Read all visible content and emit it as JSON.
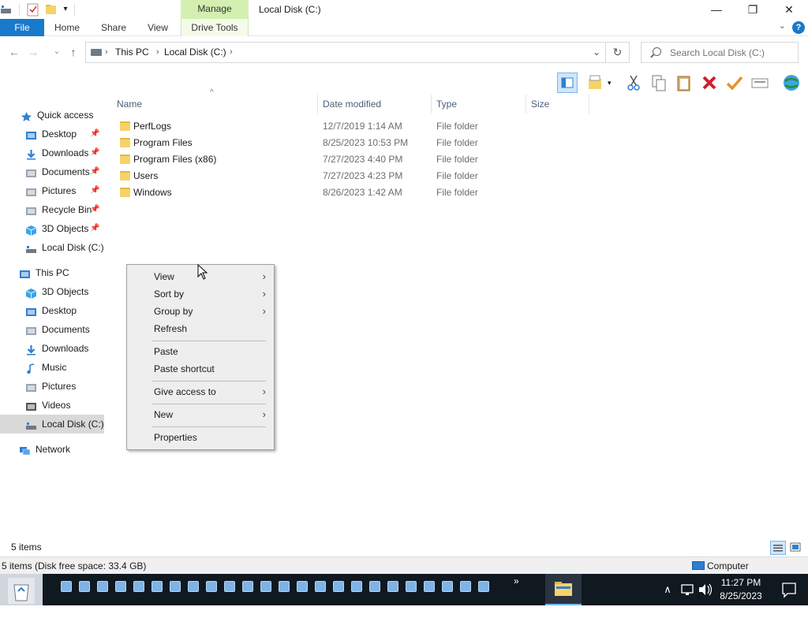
{
  "window": {
    "title": "Local Disk (C:)",
    "manage_tab": "Manage",
    "minimize": "—",
    "restore": "❐",
    "close": "✕"
  },
  "ribbon": {
    "tabs": [
      "File",
      "Home",
      "Share",
      "View",
      "Drive Tools"
    ],
    "help": "?",
    "collapse": "⌄"
  },
  "address": {
    "back": "←",
    "forward": "→",
    "recent": "⌄",
    "up": "↑",
    "segments": [
      "This PC",
      "Local Disk (C:)"
    ],
    "separator": "›",
    "dropdown": "⌄",
    "refresh": "↻"
  },
  "search": {
    "placeholder": "Search Local Disk (C:)"
  },
  "nav": {
    "items": [
      {
        "label": "Quick access",
        "icon": "star-icon",
        "pinned": false
      },
      {
        "label": "Desktop",
        "icon": "desktop-icon",
        "pinned": true
      },
      {
        "label": "Downloads",
        "icon": "download-icon",
        "pinned": true
      },
      {
        "label": "Documents",
        "icon": "documents-icon",
        "pinned": true
      },
      {
        "label": "Pictures",
        "icon": "pictures-icon",
        "pinned": true
      },
      {
        "label": "Recycle Bin",
        "icon": "recycle-bin-icon",
        "pinned": true
      },
      {
        "label": "3D Objects",
        "icon": "3d-objects-icon",
        "pinned": true
      },
      {
        "label": "Local Disk (C:)",
        "icon": "drive-icon",
        "pinned": false
      },
      {
        "label": "This PC",
        "icon": "computer-icon",
        "pinned": false
      },
      {
        "label": "3D Objects",
        "icon": "3d-objects-icon",
        "pinned": false
      },
      {
        "label": "Desktop",
        "icon": "desktop-icon",
        "pinned": false
      },
      {
        "label": "Documents",
        "icon": "documents-icon",
        "pinned": false
      },
      {
        "label": "Downloads",
        "icon": "download-icon",
        "pinned": false
      },
      {
        "label": "Music",
        "icon": "music-icon",
        "pinned": false
      },
      {
        "label": "Pictures",
        "icon": "pictures-icon",
        "pinned": false
      },
      {
        "label": "Videos",
        "icon": "videos-icon",
        "pinned": false
      },
      {
        "label": "Local Disk (C:)",
        "icon": "drive-icon",
        "pinned": false
      },
      {
        "label": "Network",
        "icon": "network-icon",
        "pinned": false
      }
    ],
    "pin_glyph": "📌"
  },
  "columns": {
    "name": "Name",
    "date": "Date modified",
    "type": "Type",
    "size": "Size",
    "sort_caret": "^"
  },
  "files": [
    {
      "name": "PerfLogs",
      "date": "12/7/2019 1:14 AM",
      "type": "File folder"
    },
    {
      "name": "Program Files",
      "date": "8/25/2023 10:53 PM",
      "type": "File folder"
    },
    {
      "name": "Program Files (x86)",
      "date": "7/27/2023 4:40 PM",
      "type": "File folder"
    },
    {
      "name": "Users",
      "date": "7/27/2023 4:23 PM",
      "type": "File folder"
    },
    {
      "name": "Windows",
      "date": "8/26/2023 1:42 AM",
      "type": "File folder"
    }
  ],
  "context_menu": {
    "items": [
      {
        "label": "View",
        "submenu": true
      },
      {
        "label": "Sort by",
        "submenu": true
      },
      {
        "label": "Group by",
        "submenu": true
      },
      {
        "label": "Refresh",
        "submenu": false
      },
      {
        "label": "Paste",
        "submenu": false
      },
      {
        "label": "Paste shortcut",
        "submenu": false
      },
      {
        "label": "Give access to",
        "submenu": true
      },
      {
        "label": "New",
        "submenu": true
      },
      {
        "label": "Properties",
        "submenu": false
      }
    ],
    "arrow": "›"
  },
  "status": {
    "items_count": "5 items",
    "info_left": "5 items (Disk free space: 33.4 GB)",
    "info_right": "Computer"
  },
  "taskbar": {
    "time": "11:27 PM",
    "date": "8/25/2023",
    "chevron": "»",
    "tray_up": "∧",
    "app_count": 24
  },
  "colors": {
    "accent": "#1979ca",
    "manage": "#d4f0b0",
    "taskbar": "#101820",
    "folder": "#f6d36a"
  }
}
